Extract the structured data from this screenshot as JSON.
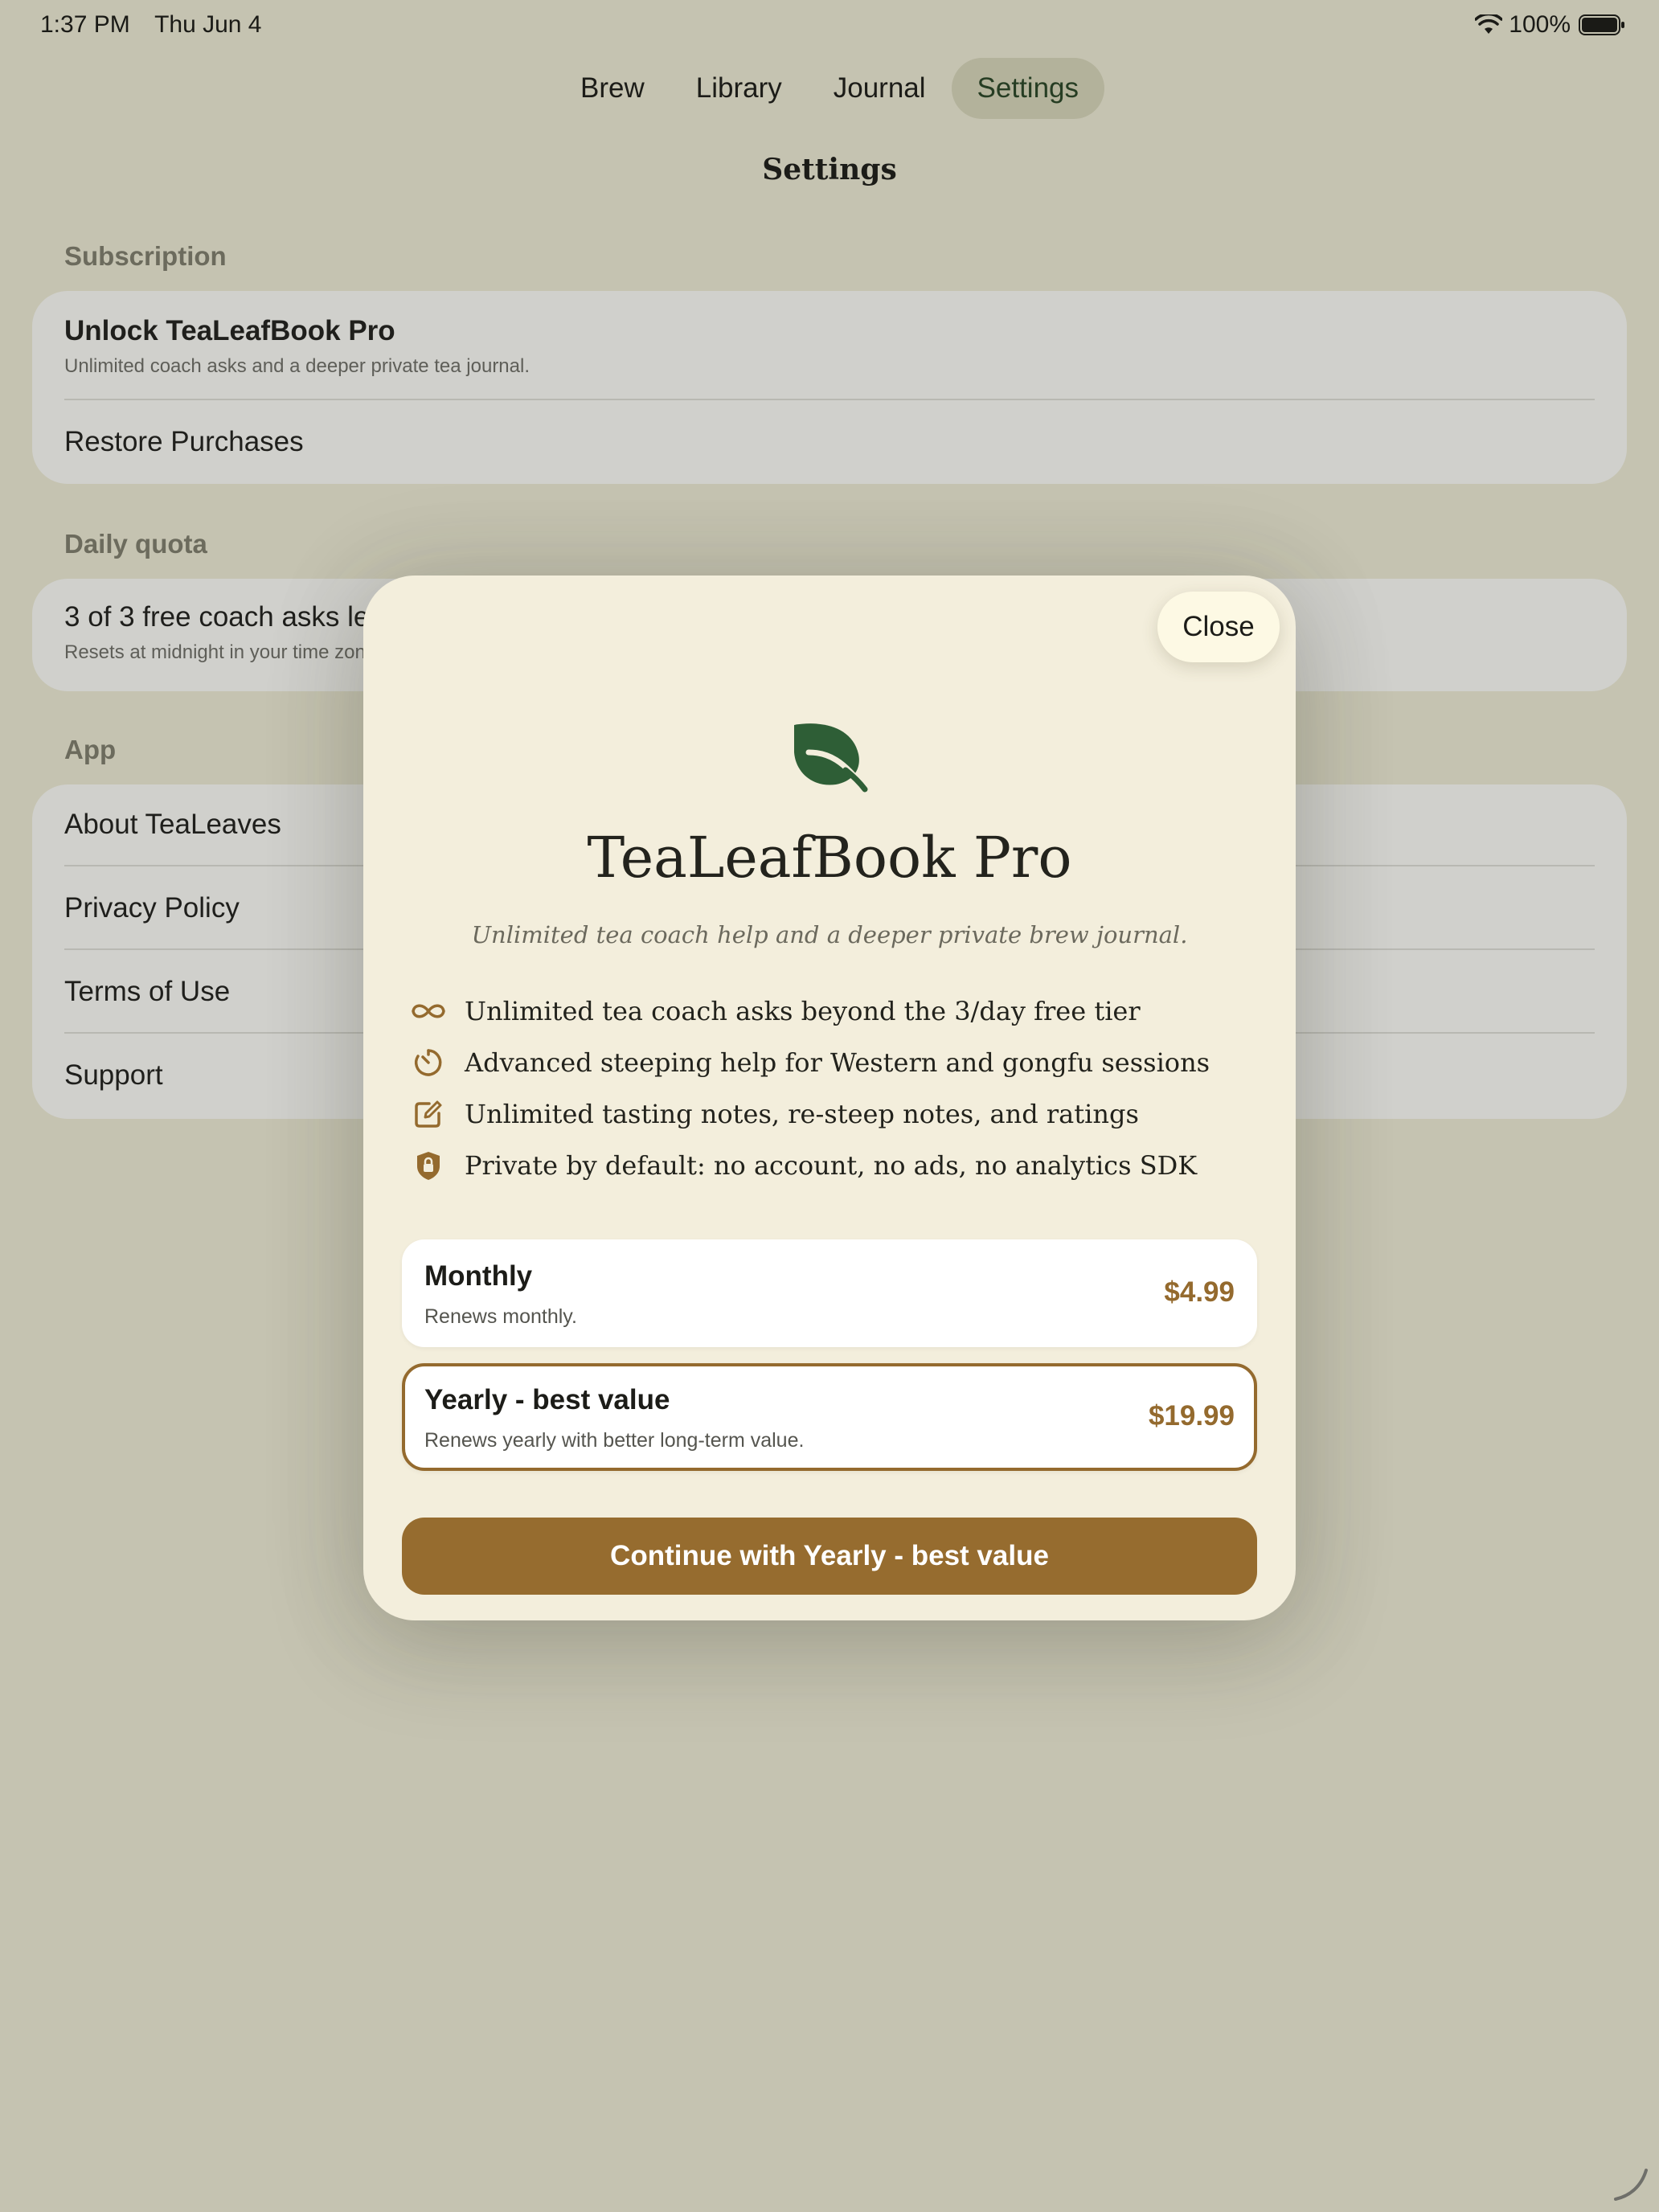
{
  "status_bar": {
    "time": "1:37 PM",
    "date": "Thu Jun 4",
    "battery": "100%"
  },
  "tabs": [
    {
      "label": "Brew",
      "active": false
    },
    {
      "label": "Library",
      "active": false
    },
    {
      "label": "Journal",
      "active": false
    },
    {
      "label": "Settings",
      "active": true
    }
  ],
  "page_title": "Settings",
  "subscription": {
    "header": "Subscription",
    "unlock_title": "Unlock TeaLeafBook Pro",
    "unlock_subtitle": "Unlimited coach asks and a deeper private tea journal.",
    "restore": "Restore Purchases"
  },
  "daily_quota": {
    "header": "Daily quota",
    "title": "3 of 3 free coach asks left",
    "subtitle": "Resets at midnight in your time zone."
  },
  "app_section": {
    "header": "App",
    "items": [
      "About TeaLeaves",
      "Privacy Policy",
      "Terms of Use",
      "Support"
    ]
  },
  "paywall": {
    "close": "Close",
    "icon": "leaf-icon",
    "title": "TeaLeafBook Pro",
    "subtitle": "Unlimited tea coach help and a deeper private brew journal.",
    "features": [
      {
        "icon": "infinity-icon",
        "text": "Unlimited tea coach asks beyond the 3/day free tier"
      },
      {
        "icon": "timer-icon",
        "text": "Advanced steeping help for Western and gongfu sessions"
      },
      {
        "icon": "edit-note-icon",
        "text": "Unlimited tasting notes, re-steep notes, and ratings"
      },
      {
        "icon": "lock-shield-icon",
        "text": "Private by default: no account, no ads, no analytics SDK"
      }
    ],
    "plans": [
      {
        "name": "Monthly",
        "description": "Renews monthly.",
        "price": "$4.99",
        "selected": false
      },
      {
        "name": "Yearly - best value",
        "description": "Renews yearly with better long-term value.",
        "price": "$19.99",
        "selected": true
      }
    ],
    "cta": "Continue with Yearly - best value"
  },
  "colors": {
    "background": "#c5c3b1",
    "accent": "#966c2f",
    "leaf": "#2e5e36",
    "modal": "#f3eedc"
  }
}
